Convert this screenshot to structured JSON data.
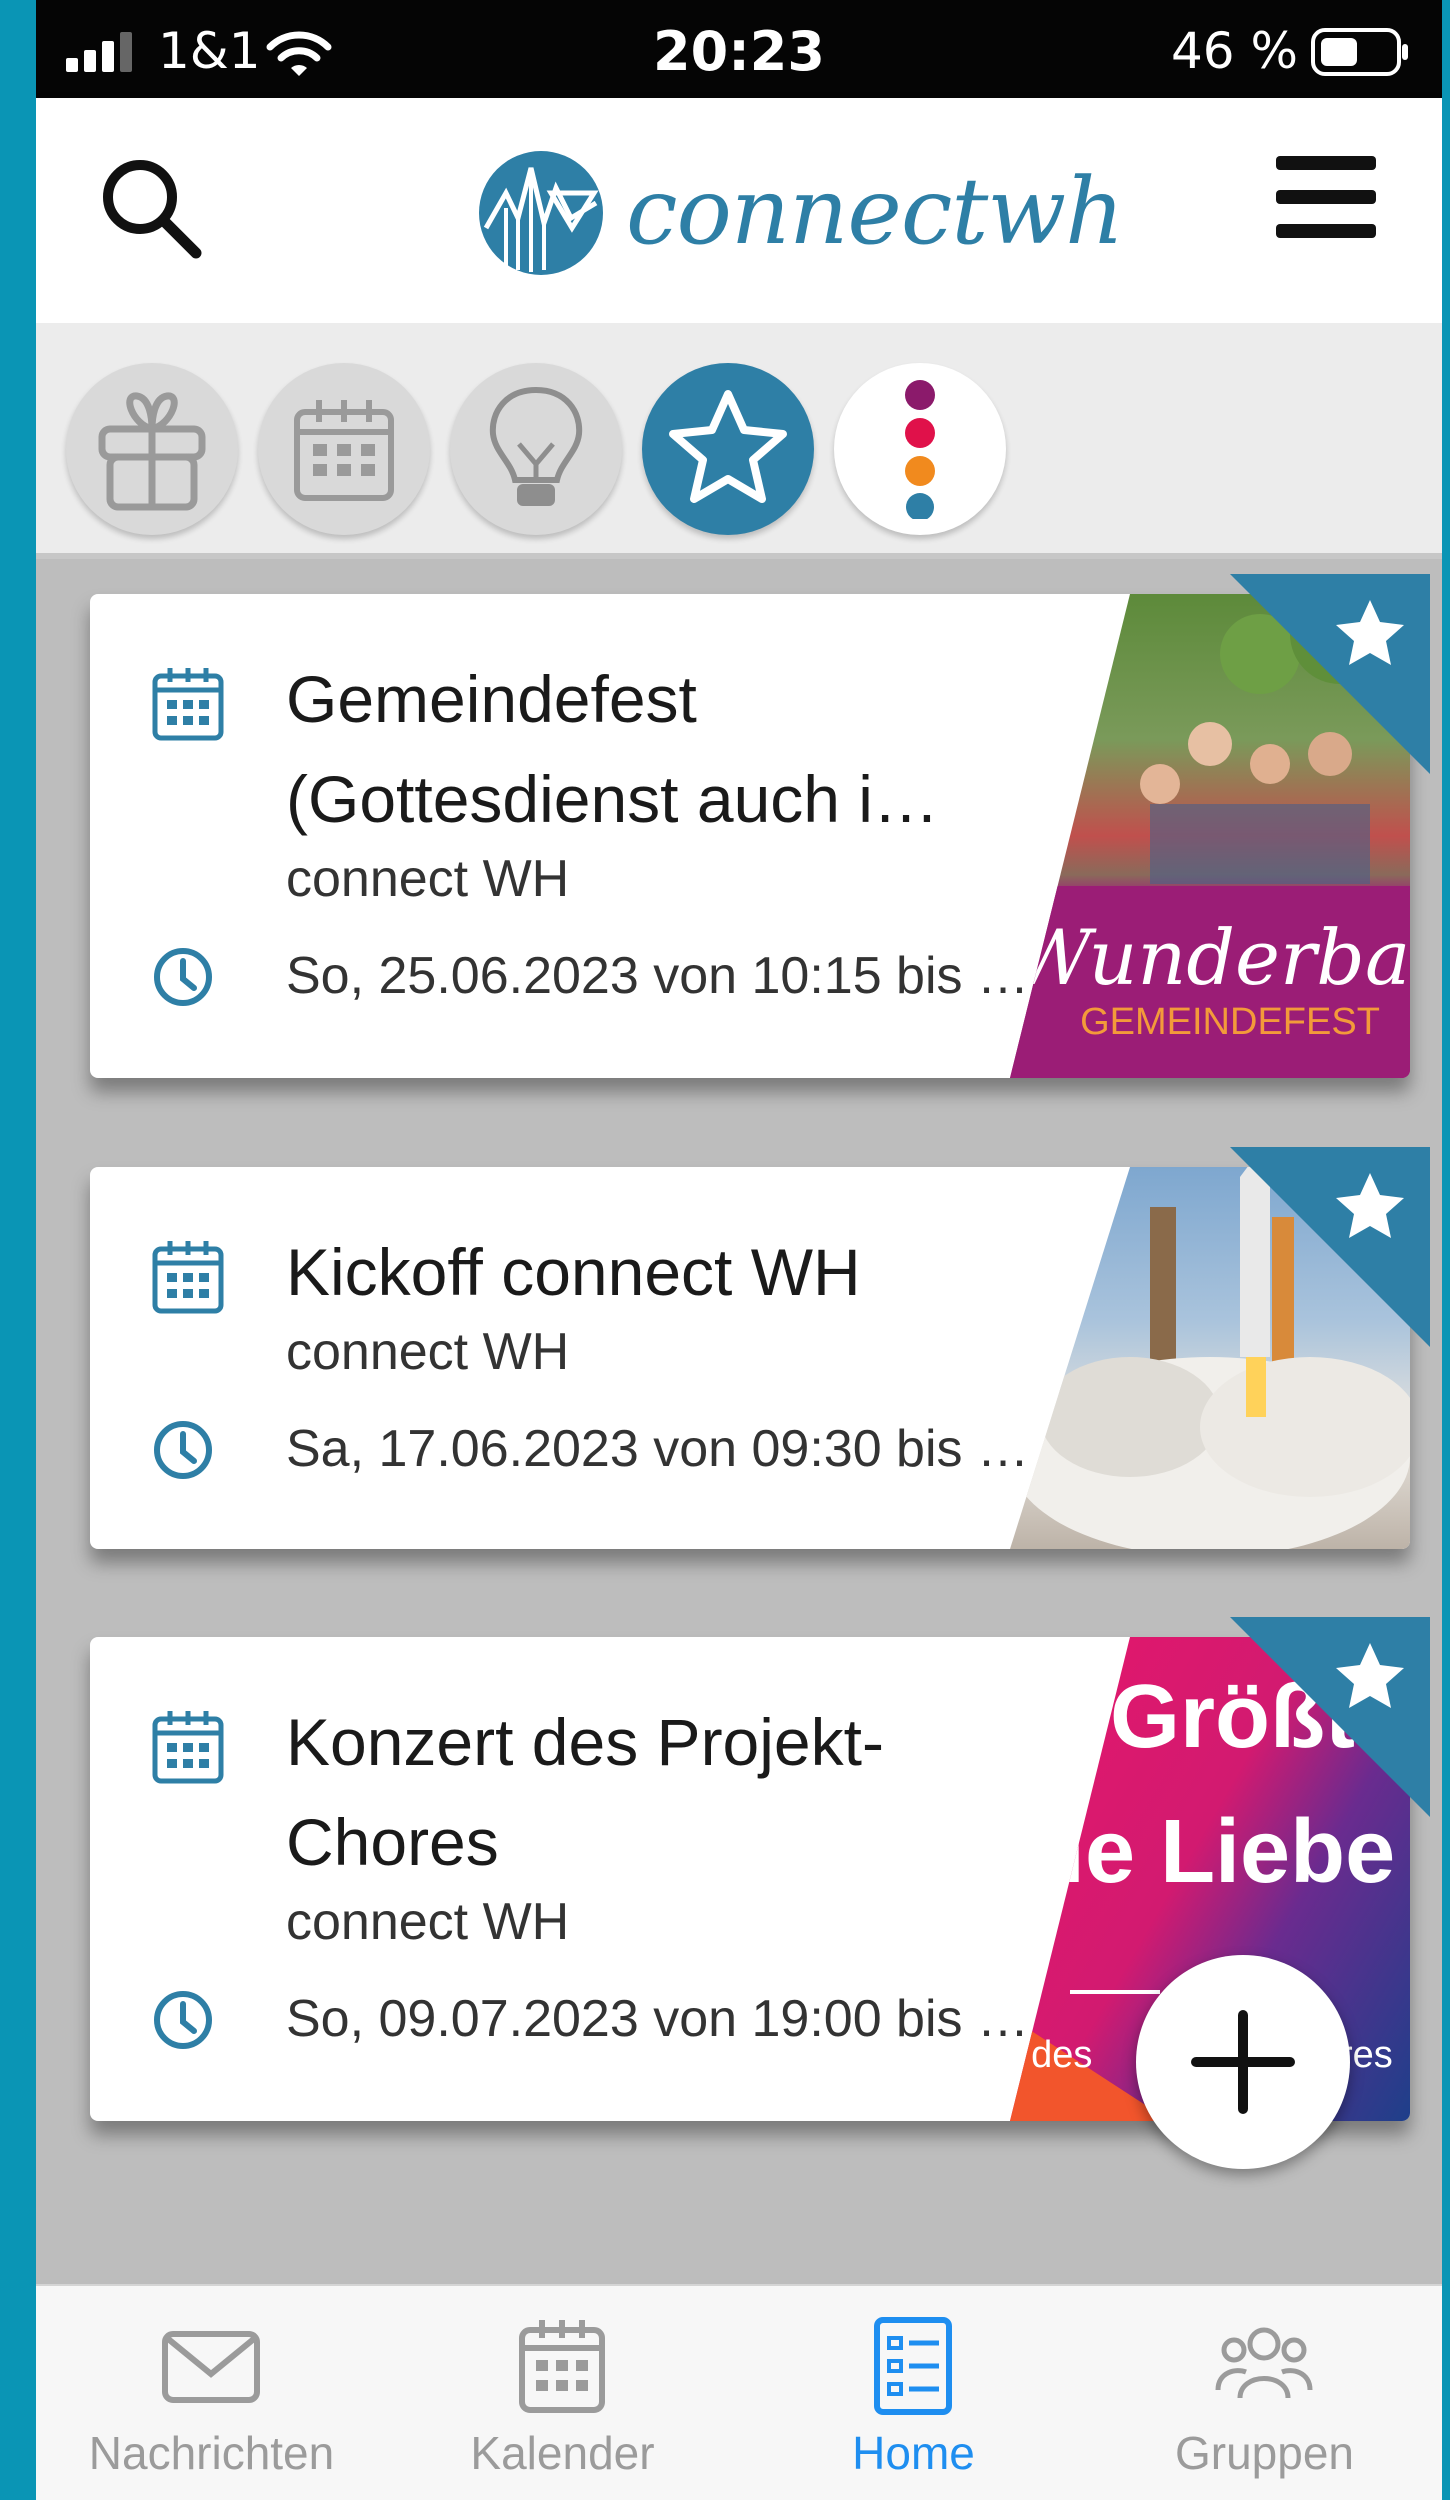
{
  "status_bar": {
    "carrier": "1&1",
    "time": "20:23",
    "battery": "46 %"
  },
  "header": {
    "logo_text": "connectwh"
  },
  "filters": [
    {
      "name": "gift-icon",
      "active": false
    },
    {
      "name": "calendar-icon",
      "active": false
    },
    {
      "name": "lightbulb-icon",
      "active": false
    },
    {
      "name": "star-icon",
      "active": true
    },
    {
      "name": "more-dots-icon",
      "active": false
    }
  ],
  "events": [
    {
      "title_line1": "Gemeindefest",
      "title_line2": "(Gottesdienst auch i…",
      "organizer": "connect WH",
      "datetime": "So, 25.06.2023 von 10:15 bis …",
      "image_text_1": "Wunderbar",
      "image_text_2": "GEMEINDEFEST",
      "favorite": true
    },
    {
      "title_line1": "Kickoff connect WH",
      "title_line2": "",
      "organizer": "connect WH",
      "datetime": "Sa, 17.06.2023 von 09:30 bis …",
      "favorite": true
    },
    {
      "title_line1": "Konzert des Projekt-",
      "title_line2": "Chores",
      "organizer": "connect WH",
      "datetime": "So, 09.07.2023 von 19:00 bis …",
      "image_text_1": "Größte",
      "image_text_2": "ie Liebe",
      "image_text_3": "t des",
      "image_text_4": "res",
      "favorite": true
    }
  ],
  "bottom_nav": [
    {
      "label": "Nachrichten",
      "icon": "mail-icon",
      "active": false
    },
    {
      "label": "Kalender",
      "icon": "calendar-icon",
      "active": false
    },
    {
      "label": "Home",
      "icon": "list-icon",
      "active": true
    },
    {
      "label": "Gruppen",
      "icon": "group-icon",
      "active": false
    }
  ],
  "colors": {
    "brand": "#2e7fa6",
    "active_nav": "#1e8ef0",
    "background": "#0a95b5"
  }
}
